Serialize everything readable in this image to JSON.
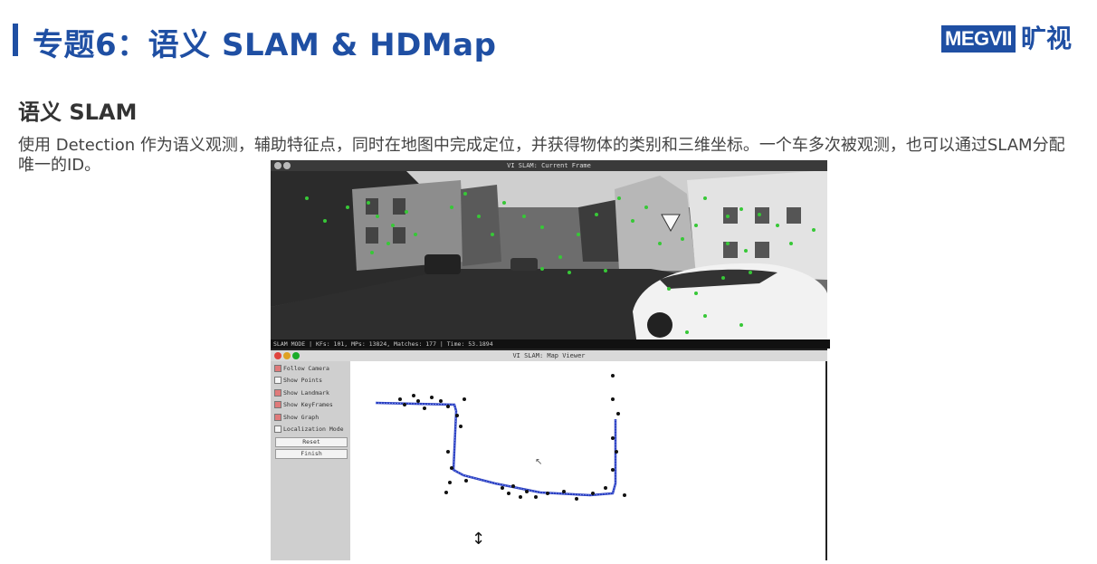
{
  "header": {
    "title": "专题6：语义 SLAM & HDMap",
    "accent_color": "#1f4fa3",
    "logo_box": "MEGVII",
    "logo_text": "旷视"
  },
  "section": {
    "title": "语义 SLAM",
    "description": "使用 Detection 作为语义观测，辅助特征点，同时在地图中完成定位，并获得物体的类别和三维坐标。一个车多次被观测，也可以通过SLAM分配唯一的ID。"
  },
  "figure": {
    "current_frame_title": "VI SLAM: Current Frame",
    "status_line": "SLAM MODE |  KFs: 101, MPs: 13824, Matches: 177 |  Time: 53.1894",
    "map_viewer_title": "VI SLAM: Map Viewer",
    "panel": {
      "options": [
        {
          "label": "Follow Camera",
          "checked": true
        },
        {
          "label": "Show Points",
          "checked": false
        },
        {
          "label": "Show Landmark",
          "checked": true
        },
        {
          "label": "Show KeyFrames",
          "checked": true
        },
        {
          "label": "Show Graph",
          "checked": true
        },
        {
          "label": "Localization Mode",
          "checked": false
        }
      ],
      "reset_label": "Reset",
      "finish_label": "Finish"
    },
    "feature_color": "#37c837",
    "trajectory_color": "#2a3fbf"
  }
}
